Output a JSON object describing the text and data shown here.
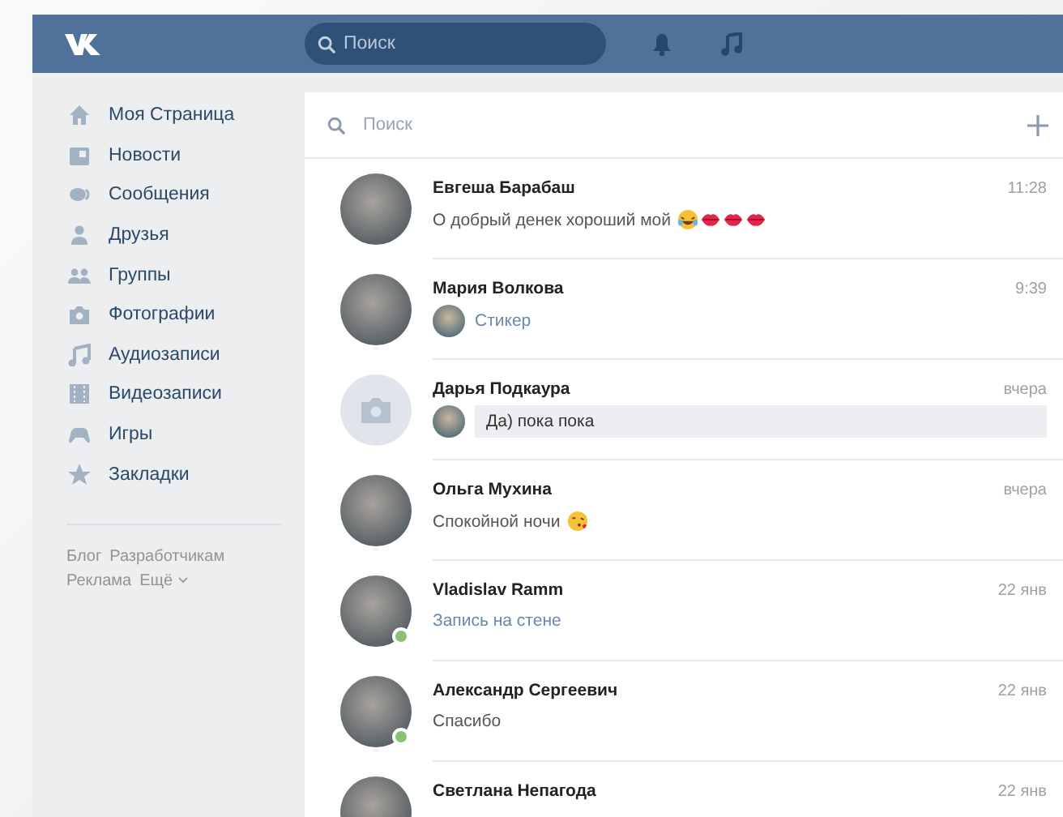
{
  "header": {
    "search": {
      "placeholder": "Поиск"
    }
  },
  "sidebar": {
    "items": [
      {
        "label": "Моя Страница",
        "kind": "home"
      },
      {
        "label": "Новости",
        "kind": "news"
      },
      {
        "label": "Сообщения",
        "kind": "messages"
      },
      {
        "label": "Друзья",
        "kind": "friends"
      },
      {
        "label": "Группы",
        "kind": "groups"
      },
      {
        "label": "Фотографии",
        "kind": "photos"
      },
      {
        "label": "Аудиозаписи",
        "kind": "audio"
      },
      {
        "label": "Видеозаписи",
        "kind": "video"
      },
      {
        "label": "Игры",
        "kind": "games"
      },
      {
        "label": "Закладки",
        "kind": "bookmarks"
      }
    ],
    "footer_links": [
      "Блог",
      "Разработчикам",
      "Реклама"
    ],
    "more": "Ещё"
  },
  "dialogs": {
    "search": {
      "placeholder": "Поиск"
    },
    "conversations": [
      {
        "name": "Евгеша Барабаш",
        "time": "11:28",
        "avatar": {
          "kind": "photo"
        },
        "online": false,
        "kind": "text",
        "message": "О добрый денек хороший мой",
        "emoji": [
          {
            "kind": "tears-of-joy"
          },
          {
            "kind": "lips"
          },
          {
            "kind": "lips"
          },
          {
            "kind": "lips"
          }
        ]
      },
      {
        "name": "Мария Волкова",
        "time": "9:39",
        "avatar": {
          "kind": "photo"
        },
        "online": false,
        "kind": "attachment",
        "sender_avatar": true,
        "message": "Стикер"
      },
      {
        "name": "Дарья Подкаура",
        "time": "вчера",
        "avatar": {
          "kind": "camera"
        },
        "online": false,
        "kind": "unread",
        "sender_avatar": true,
        "message": "Да) пока пока"
      },
      {
        "name": "Ольга Мухина",
        "time": "вчера",
        "avatar": {
          "kind": "photo"
        },
        "online": false,
        "kind": "text",
        "message": "Спокойной ночи",
        "emoji": [
          {
            "kind": "kiss-face"
          }
        ]
      },
      {
        "name": "Vladislav Ramm",
        "time": "22 янв",
        "avatar": {
          "kind": "photo"
        },
        "online": true,
        "kind": "attachment",
        "message": "Запись на стене"
      },
      {
        "name": "Александр Сергеевич",
        "time": "22 янв",
        "avatar": {
          "kind": "photo"
        },
        "online": true,
        "kind": "text",
        "message": "Спасибо"
      },
      {
        "name": "Светлана Непагода",
        "time": "22 янв",
        "avatar": {
          "kind": "photo"
        },
        "online": false
      }
    ]
  }
}
